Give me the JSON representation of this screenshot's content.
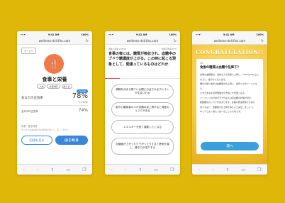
{
  "colors": {
    "background": "#dfb709",
    "accent_blue": "#3a86d8",
    "accent_orange": "#ef7a47",
    "progress_red": "#e2453c"
  },
  "browser": {
    "time": "9:41 AM",
    "battery": "100%",
    "url": "wellness-drill.finc.com"
  },
  "screen1": {
    "home_tag": "ホームへ",
    "icon": "fork-knife-icon",
    "title": "食事と栄養",
    "tags": [
      "以前",
      "食事制限",
      "飲り食"
    ],
    "clear_badge": "CLEAR",
    "score_label": "あなたの正答率",
    "score_value": "78%",
    "score_sub": "(10/10問)",
    "avg_label": "全体平均正答率",
    "avg_value": "74%",
    "note1": "所要・推定時間",
    "note2": "食べ方や食事内容の知識問題を解いて、楽しく学ぼう",
    "review_button": "回答を見る",
    "start_button": "はじめる"
  },
  "screen2": {
    "category": "食事と栄養 ※18/10",
    "meta": "問題正答率 67%",
    "question": "食事の後には、糖質が吸収され、血糖中のブドウ糖濃度が上がる。この時に起こる現象として、間違っているものはどれか",
    "progress": 0.2,
    "options": [
      "膵臓を休ませ寝ている間に分泌されるホルモンが生成される",
      "脳や心臓疾患の人が血糖の急上昇すると発症のリスクがある",
      "エネルギーを使て運動したくなる",
      "血糖値が上がったり下がったりすると眠気を催し、集中力が低下する"
    ]
  },
  "screen3": {
    "banner": "CONGRATULATION!!",
    "label": "問4",
    "question": "食後の糖質は血糖や乱降下？",
    "body": [
      "食後の血糖値は、健常な人が食後に上昇し、140mg/dl以上になると、緩やかに元に戻る。",
      "糖分の取り過ぎは血糖値が急上昇し、血管へのダメージになり、",
      "さまざまな生活習慣病を引き起こす原因となる。",
      "インスリンの分泌が不十分な人は高血糖の状態が続き、",
      "動脈硬化のリスクが高まります。食事の際は野菜から先に",
      "食べるなど、血糖値の急上昇を抑える工夫をしましょう。",
      "ゆっくりよく噛んで食べることも大切です。"
    ],
    "next_button": "次へ"
  }
}
